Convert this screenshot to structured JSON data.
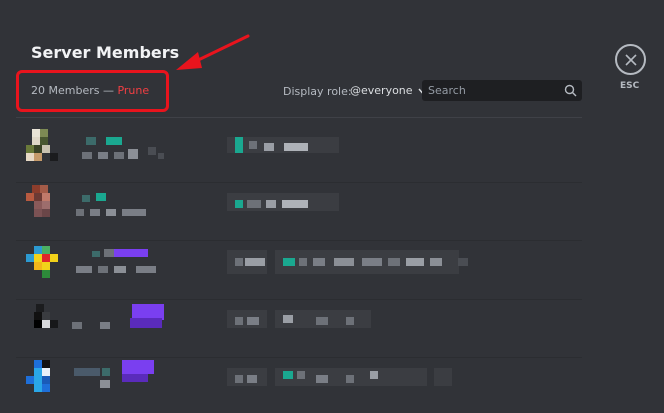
{
  "header": {
    "title": "Server Members",
    "member_count": "20 Members — ",
    "prune_label": "Prune",
    "display_role_label": "Display role:",
    "role_selected": "@everyone",
    "search_placeholder": "Search"
  },
  "close": {
    "esc_label": "ESC"
  },
  "members": [
    {
      "row": 1
    },
    {
      "row": 2
    },
    {
      "row": 3
    },
    {
      "row": 4
    },
    {
      "row": 5
    }
  ],
  "colors": {
    "background": "#313338",
    "prune": "#f23f43",
    "annotation": "#e8141d"
  }
}
